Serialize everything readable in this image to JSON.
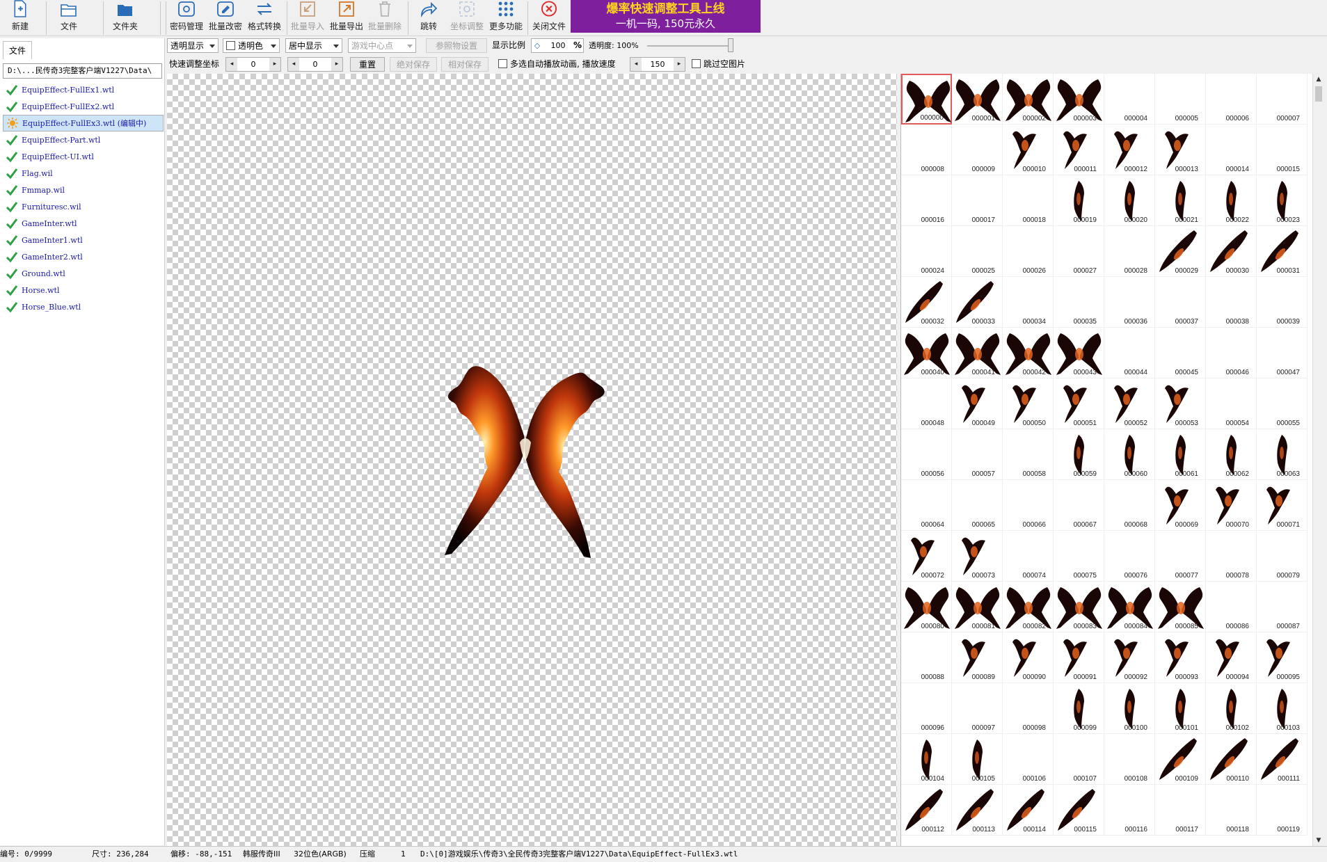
{
  "toolbar": {
    "new": "新建",
    "file": "文件",
    "folder": "文件夹",
    "password": "密码管理",
    "batch_rename": "批量改密",
    "format_convert": "格式转换",
    "batch_import": "批量导入",
    "batch_export": "批量导出",
    "batch_delete": "批量删除",
    "jump": "跳转",
    "coord_adjust": "坐标调整",
    "more": "更多功能",
    "close_file": "关闭文件"
  },
  "banner": {
    "line1": "爆率快速调整工具上线",
    "line2": "一机一码, 150元永久"
  },
  "left": {
    "tab": "文件",
    "path": "D:\\...民传奇3完整客户端V1227\\Data\\",
    "files": [
      {
        "name": "EquipEffect-FullEx1.wtl",
        "state": "ok"
      },
      {
        "name": "EquipEffect-FullEx2.wtl",
        "state": "ok"
      },
      {
        "name": "EquipEffect-FullEx3.wtl (编辑中)",
        "state": "editing"
      },
      {
        "name": "EquipEffect-Part.wtl",
        "state": "ok"
      },
      {
        "name": "EquipEffect-UI.wtl",
        "state": "ok"
      },
      {
        "name": "Flag.wil",
        "state": "ok"
      },
      {
        "name": "Fmmap.wil",
        "state": "ok"
      },
      {
        "name": "Furnituresc.wil",
        "state": "ok"
      },
      {
        "name": "GameInter.wtl",
        "state": "ok"
      },
      {
        "name": "GameInter1.wtl",
        "state": "ok"
      },
      {
        "name": "GameInter2.wtl",
        "state": "ok"
      },
      {
        "name": "Ground.wtl",
        "state": "ok"
      },
      {
        "name": "Horse.wtl",
        "state": "ok"
      },
      {
        "name": "Horse_Blue.wtl",
        "state": "ok"
      }
    ]
  },
  "opts1": {
    "transparent_display": "透明显示",
    "transparent_color": "透明色",
    "center_display": "居中显示",
    "game_center": "游戏中心点",
    "ref_settings": "参照物设置",
    "scale_label": "显示比例",
    "scale_value": "100",
    "scale_unit": "%",
    "opacity_label": "透明度: 100%",
    "opacity_level": 1.0
  },
  "opts2": {
    "quick_coord": "快速调整坐标",
    "x_value": "0",
    "y_value": "0",
    "reset": "重置",
    "abs_save": "绝对保存",
    "rel_save": "相对保存",
    "multi_auto_play": "多选自动播放动画, 播放速度",
    "speed_value": "150",
    "skip_empty": "跳过空图片"
  },
  "frames": {
    "labels": [
      "000000",
      "000001",
      "000002",
      "000003",
      "000004",
      "000005",
      "000006",
      "000007",
      "000008",
      "000009",
      "000010",
      "000011",
      "000012",
      "000013",
      "000014",
      "000015",
      "000016",
      "000017",
      "000018",
      "000019",
      "000020",
      "000021",
      "000022",
      "000023",
      "000024",
      "000025",
      "000026",
      "000027",
      "000028",
      "000029",
      "000030",
      "000031",
      "000032",
      "000033",
      "000034",
      "000035",
      "000036",
      "000037",
      "000038",
      "000039",
      "000040",
      "000041",
      "000042",
      "000043",
      "000044",
      "000045",
      "000046",
      "000047",
      "000048",
      "000049",
      "000050",
      "000051",
      "000052",
      "000053",
      "000054",
      "000055",
      "000056",
      "000057",
      "000058",
      "000059",
      "000060",
      "000061",
      "000062",
      "000063",
      "000064",
      "000065",
      "000066",
      "000067",
      "000068",
      "000069",
      "000070",
      "000071",
      "000072",
      "000073",
      "000074",
      "000075",
      "000076",
      "000077",
      "000078",
      "000079",
      "000080",
      "000081",
      "000082",
      "000083",
      "000084",
      "000085",
      "000086",
      "000087",
      "000088",
      "000089",
      "000090",
      "000091",
      "000092",
      "000093",
      "000094",
      "000095",
      "000096",
      "000097",
      "000098",
      "000099",
      "000100",
      "000101",
      "000102",
      "000103",
      "000104",
      "000105",
      "000106",
      "000107",
      "000108",
      "000109",
      "000110",
      "000111",
      "000112",
      "000113",
      "000114",
      "000115",
      "000116",
      "000117",
      "000118",
      "000119"
    ],
    "selected": 0
  },
  "status": {
    "index": "编号: 0/9999",
    "size": "尺寸: 236,284",
    "offset": "偏移: -88,-151",
    "version": "韩服传奇III",
    "color_depth": "32位色(ARGB)",
    "compress": "压缩",
    "compress_value": "1",
    "filepath": "D:\\[0]游戏娱乐\\传奇3\\全民传奇3完整客户端V1227\\Data\\EquipEffect-FullEx3.wtl"
  }
}
